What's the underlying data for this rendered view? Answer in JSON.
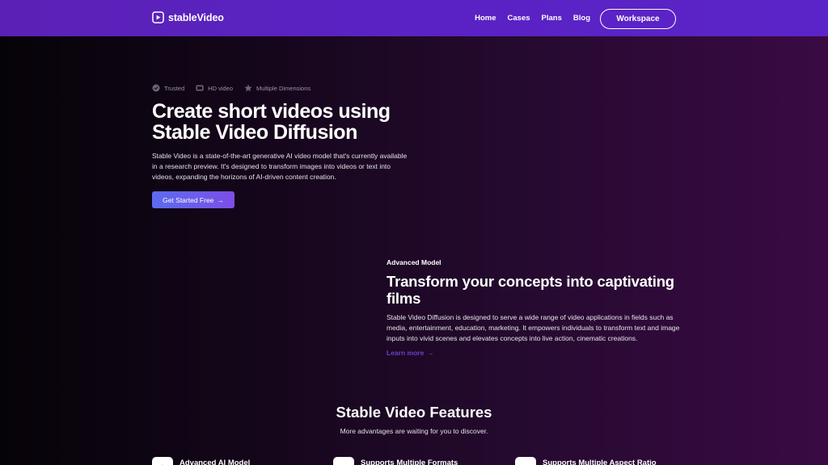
{
  "nav": {
    "brand": "stableVideo",
    "links": [
      "Home",
      "Cases",
      "Plans",
      "Blog"
    ],
    "workspace_label": "Workspace"
  },
  "hero": {
    "badges": [
      {
        "icon": "shield-check-icon",
        "label": "Trusted"
      },
      {
        "icon": "video-icon",
        "label": "HD video"
      },
      {
        "icon": "star-icon",
        "label": "Multiple Dimensions"
      }
    ],
    "title_line1": "Create short videos using",
    "title_line2": "Stable Video Diffusion",
    "description": "Stable Video is a state-of-the-art generative AI video model that's currently available in a research preview. It's designed to transform images into videos or text into videos, expanding the horizons of AI-driven content creation.",
    "cta_label": "Get Started Free",
    "cta_arrow": "→"
  },
  "model_section": {
    "tag": "Advanced Model",
    "title_line1": "Transform your concepts into captivating",
    "title_line2": "films",
    "description": "Stable Video Diffusion is designed to serve a wide range of video applications in fields such as media, entertainment, education, marketing. It empowers individuals to transform text and image inputs into vivid scenes and elevates concepts into live action, cinematic creations.",
    "learn_more": "Learn more",
    "learn_more_arrow": "→"
  },
  "features": {
    "title": "Stable Video Features",
    "subtitle": "More advantages are waiting for you to discover.",
    "items": [
      {
        "icon": "sparkle-icon",
        "title": "Advanced AI Model"
      },
      {
        "icon": "layers-icon",
        "title": "Supports Multiple Formats"
      },
      {
        "icon": "aspect-ratio-icon",
        "title": "Supports Multiple Aspect Ratio"
      }
    ]
  },
  "colors": {
    "nav_bg": "#5b21b6",
    "accent": "#7c3aed",
    "cta_gradient_start": "#5b6cf0",
    "cta_gradient_end": "#7c4ee6",
    "learn_more": "#6d3fc9"
  }
}
